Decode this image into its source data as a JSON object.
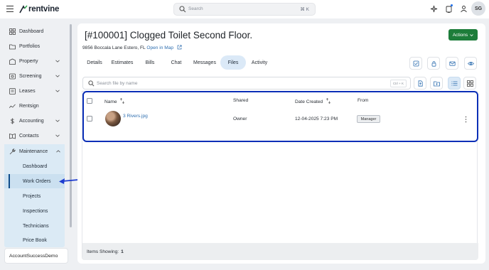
{
  "app": {
    "name": "rentvine",
    "user_initials": "SG"
  },
  "search": {
    "placeholder": "Search",
    "shortcut": "⌘ K"
  },
  "sidebar": {
    "items": [
      {
        "label": "Dashboard"
      },
      {
        "label": "Portfolios"
      },
      {
        "label": "Property"
      },
      {
        "label": "Screening"
      },
      {
        "label": "Leases"
      },
      {
        "label": "Rentsign"
      },
      {
        "label": "Accounting"
      },
      {
        "label": "Contacts"
      },
      {
        "label": "Maintenance"
      }
    ],
    "maintenance_sub": [
      {
        "label": "Dashboard"
      },
      {
        "label": "Work Orders"
      },
      {
        "label": "Projects"
      },
      {
        "label": "Inspections"
      },
      {
        "label": "Technicians"
      },
      {
        "label": "Price Book"
      }
    ],
    "account": "AccountSuccessDemo"
  },
  "work_order": {
    "title": "[#100001] Clogged Toilet Second Floor.",
    "address": "9856 Boccala Lane Estero, FL",
    "map_link": "Open in Map",
    "actions_label": "Actions"
  },
  "tabs": [
    {
      "label": "Details"
    },
    {
      "label": "Estimates"
    },
    {
      "label": "Bills"
    },
    {
      "label": "Chat"
    },
    {
      "label": "Messages"
    },
    {
      "label": "Files"
    },
    {
      "label": "Activity"
    }
  ],
  "files": {
    "search_placeholder": "Search file by name",
    "search_shortcut": "Ctrl + K",
    "columns": {
      "name": "Name",
      "shared": "Shared",
      "date_created": "Date Created",
      "from": "From"
    },
    "rows": [
      {
        "name": "3 Rivers.jpg",
        "shared": "Owner",
        "date_created": "12-04-2025 7:23 PM",
        "from": "Manager"
      }
    ],
    "footer_label": "Items Showing:",
    "items_count": "1"
  },
  "colors": {
    "accent": "#2f6fb0",
    "actions_button": "#1d7d3a",
    "highlight_border": "#0b2fb7",
    "active_tab": "#dbe9f7"
  }
}
